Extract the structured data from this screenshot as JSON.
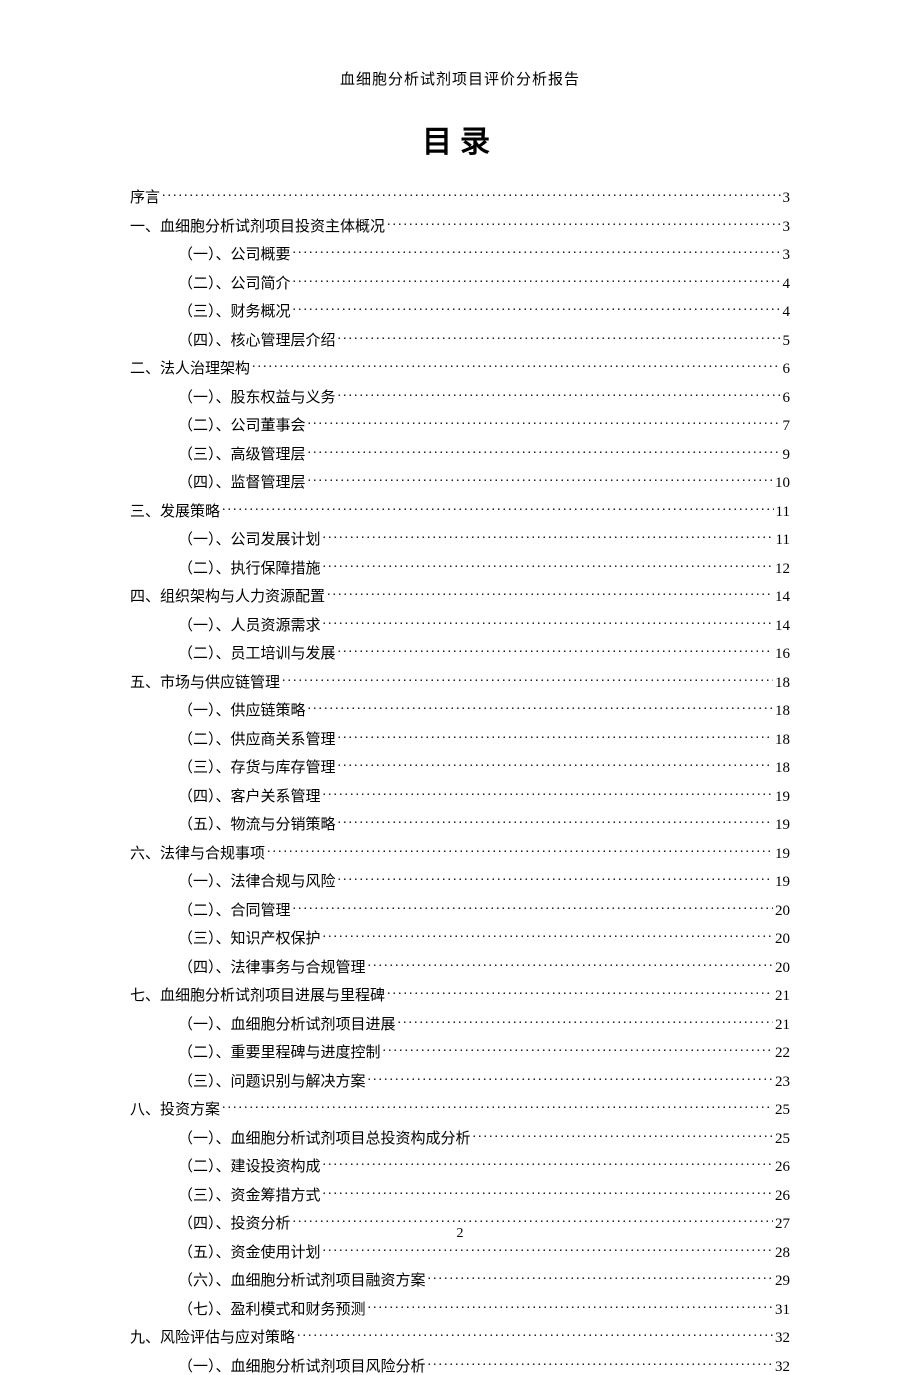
{
  "header": {
    "title": "血细胞分析试剂项目评价分析报告"
  },
  "toc_title": "目录",
  "page_number": "2",
  "toc": [
    {
      "level": 0,
      "label": "序言",
      "page": "3"
    },
    {
      "level": 0,
      "label": "一、血细胞分析试剂项目投资主体概况",
      "page": "3"
    },
    {
      "level": 1,
      "label": "（一）、公司概要",
      "page": "3"
    },
    {
      "level": 1,
      "label": "（二）、公司简介",
      "page": "4"
    },
    {
      "level": 1,
      "label": "（三）、财务概况",
      "page": "4"
    },
    {
      "level": 1,
      "label": "（四）、核心管理层介绍",
      "page": "5"
    },
    {
      "level": 0,
      "label": "二、法人治理架构",
      "page": "6"
    },
    {
      "level": 1,
      "label": "（一）、股东权益与义务",
      "page": "6"
    },
    {
      "level": 1,
      "label": "（二）、公司董事会",
      "page": "7"
    },
    {
      "level": 1,
      "label": "（三）、高级管理层",
      "page": "9"
    },
    {
      "level": 1,
      "label": "（四）、监督管理层",
      "page": "10"
    },
    {
      "level": 0,
      "label": "三、发展策略",
      "page": "11"
    },
    {
      "level": 1,
      "label": "（一）、公司发展计划",
      "page": "11"
    },
    {
      "level": 1,
      "label": "（二）、执行保障措施",
      "page": "12"
    },
    {
      "level": 0,
      "label": "四、组织架构与人力资源配置",
      "page": "14"
    },
    {
      "level": 1,
      "label": "（一）、人员资源需求",
      "page": "14"
    },
    {
      "level": 1,
      "label": "（二）、员工培训与发展",
      "page": "16"
    },
    {
      "level": 0,
      "label": "五、市场与供应链管理",
      "page": "18"
    },
    {
      "level": 1,
      "label": "（一）、供应链策略",
      "page": "18"
    },
    {
      "level": 1,
      "label": "（二）、供应商关系管理",
      "page": "18"
    },
    {
      "level": 1,
      "label": "（三）、存货与库存管理",
      "page": "18"
    },
    {
      "level": 1,
      "label": "（四）、客户关系管理",
      "page": "19"
    },
    {
      "level": 1,
      "label": "（五）、物流与分销策略",
      "page": "19"
    },
    {
      "level": 0,
      "label": "六、法律与合规事项",
      "page": "19"
    },
    {
      "level": 1,
      "label": "（一）、法律合规与风险",
      "page": "19"
    },
    {
      "level": 1,
      "label": "（二）、合同管理",
      "page": "20"
    },
    {
      "level": 1,
      "label": "（三）、知识产权保护",
      "page": "20"
    },
    {
      "level": 1,
      "label": "（四）、法律事务与合规管理",
      "page": "20"
    },
    {
      "level": 0,
      "label": "七、血细胞分析试剂项目进展与里程碑",
      "page": "21"
    },
    {
      "level": 1,
      "label": "（一）、血细胞分析试剂项目进展",
      "page": "21"
    },
    {
      "level": 1,
      "label": "（二）、重要里程碑与进度控制",
      "page": "22"
    },
    {
      "level": 1,
      "label": "（三）、问题识别与解决方案",
      "page": "23"
    },
    {
      "level": 0,
      "label": "八、投资方案",
      "page": "25"
    },
    {
      "level": 1,
      "label": "（一）、血细胞分析试剂项目总投资构成分析",
      "page": "25"
    },
    {
      "level": 1,
      "label": "（二）、建设投资构成",
      "page": "26"
    },
    {
      "level": 1,
      "label": "（三）、资金筹措方式",
      "page": "26"
    },
    {
      "level": 1,
      "label": "（四）、投资分析",
      "page": "27"
    },
    {
      "level": 1,
      "label": "（五）、资金使用计划",
      "page": "28"
    },
    {
      "level": 1,
      "label": "（六）、血细胞分析试剂项目融资方案",
      "page": "29"
    },
    {
      "level": 1,
      "label": "（七）、盈利模式和财务预测",
      "page": "31"
    },
    {
      "level": 0,
      "label": "九、风险评估与应对策略",
      "page": "32"
    },
    {
      "level": 1,
      "label": "（一）、血细胞分析试剂项目风险分析",
      "page": "32"
    }
  ]
}
